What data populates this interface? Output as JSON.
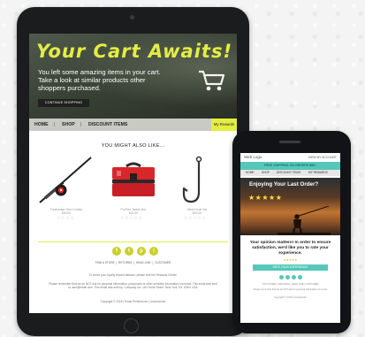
{
  "tablet": {
    "hero": {
      "title": "Your Cart Awaits!",
      "message": "You left some amazing items in your cart. Take a look at similar products other shoppers purchased.",
      "button_label": "CONTINUE SHOPPING"
    },
    "nav": {
      "items": [
        "HOME",
        "SHOP",
        "DISCOUNT ITEMS"
      ],
      "separator": "|",
      "rewards_label": "My Rewards"
    },
    "section_title": "YOU MIGHT ALSO LIKE...",
    "products": [
      {
        "icon": "fishing-reel-icon",
        "name": "Freshwater Reel Combo",
        "price": "$00.00",
        "stars": "☆☆☆☆"
      },
      {
        "icon": "tackle-box-icon",
        "name": "ProFlex Tackle Box",
        "price": "$00.00",
        "stars": "☆☆☆☆☆"
      },
      {
        "icon": "fishing-hook-icon",
        "name": "Steel Hook Set",
        "price": "$00.00",
        "stars": "☆☆☆☆☆"
      }
    ],
    "social": [
      "f",
      "t",
      "p",
      "i"
    ],
    "footer_links": [
      "FIND A STORE",
      "|",
      "RETURNS",
      "|",
      "HEAD LINE",
      "|",
      "CUSTOMER"
    ],
    "fineprint": [
      "To check your loyalty reward balance, please visit the Rewards Center.",
      "Please remember that we do NOT ask for personal information, passwords or other sensitive information via email. This email was sent to user@email.com. This email was sent by: Company Inc. 100 Some Street, New York, NY 10001 USA",
      "Copyright © 2018 | Email Preferences | Unsubscribe"
    ]
  },
  "phone": {
    "logo": "Web Logo",
    "account": "VIEW MY ACCOUNT",
    "promo": "FREE SHIPPING ON ORDERS $50+",
    "nav": [
      "HOME",
      "SHOP",
      "DISCOUNT ITEMS",
      "MY REWARDS"
    ],
    "hero_title": "Enjoying Your Last Order?",
    "hero_stars": "★★★★★",
    "message": "Your opinion matters! In order to ensure satisfaction, we'd like you to rate your experience.",
    "small_stars": "★★★★★",
    "cta_label": "RATE YOUR EXPERIENCE",
    "footer": [
      "TOP STORES | RETURNS | HEAD LINE | CUSTOMER",
      "Please remember that we do NOT ask for personal information via email.",
      "Copyright © 2018 | Unsubscribe"
    ]
  },
  "colors": {
    "accent": "#e4ee42",
    "phone_accent": "#55c8ba",
    "device": "#1b1c1e",
    "nav_bg": "#c9cac4"
  }
}
